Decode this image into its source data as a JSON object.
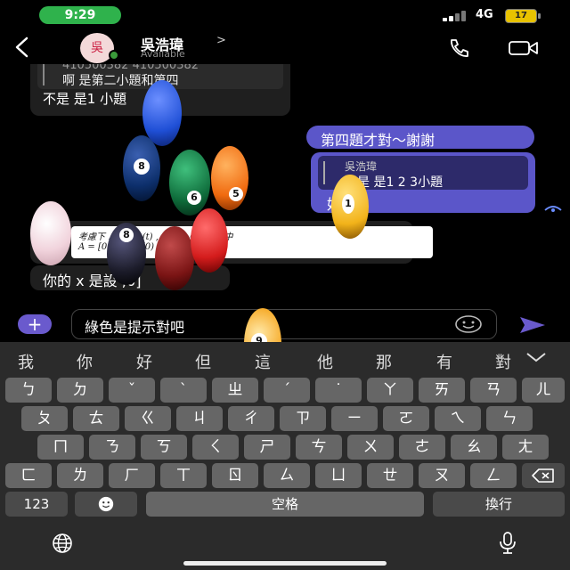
{
  "status_bar": {
    "time": "9:29",
    "network": "4G",
    "battery": "17"
  },
  "header": {
    "name": "吳浩瑋",
    "chevron": ">",
    "status": "Available",
    "avatar_text": "吳"
  },
  "messages": {
    "m1": {
      "quote_text": "410500382 410500382",
      "quote_body": "啊 是第二小題和第四",
      "body": "不是 是1 小題"
    },
    "m2": {
      "body": "第四題才對～謝謝"
    },
    "m3": {
      "quote_name": "吳浩瑋",
      "quote_body": "不是 是1 2 3小題",
      "body": "好"
    },
    "m4": {
      "equation": "考慮下 …      + Bu(t) ,  y(t) = Cx(t)  其中",
      "matrix_row": "A = [0 …   0], x(0) = [5/2] ."
    },
    "m5": {
      "body": "你的 x 是設 ;0]"
    }
  },
  "composer": {
    "text": "綠色是提示對吧",
    "plus_label": "+"
  },
  "keyboard": {
    "suggestions": [
      "我",
      "你",
      "好",
      "但",
      "這",
      "他",
      "那",
      "有",
      "對"
    ],
    "row1": [
      "ㄅ",
      "ㄉ",
      "ˇ",
      "ˋ",
      "ㄓ",
      "ˊ",
      "˙",
      "ㄚ",
      "ㄞ",
      "ㄢ",
      "ㄦ"
    ],
    "row2": [
      "ㄆ",
      "ㄊ",
      "ㄍ",
      "ㄐ",
      "ㄔ",
      "ㄗ",
      "ㄧ",
      "ㄛ",
      "ㄟ",
      "ㄣ"
    ],
    "row3": [
      "ㄇ",
      "ㄋ",
      "ㄎ",
      "ㄑ",
      "ㄕ",
      "ㄘ",
      "ㄨ",
      "ㄜ",
      "ㄠ",
      "ㄤ"
    ],
    "row4": [
      "ㄈ",
      "ㄌ",
      "ㄏ",
      "ㄒ",
      "ㄖ",
      "ㄙ",
      "ㄩ",
      "ㄝ",
      "ㄡ",
      "ㄥ"
    ],
    "numbers_key": "123",
    "space_key": "空格",
    "return_key": "換行"
  },
  "balls": [
    {
      "number": "",
      "color": "#1f4fd6"
    },
    {
      "number": "8",
      "color": "#0d2f6b"
    },
    {
      "number": "6",
      "color": "#0e6b3a"
    },
    {
      "number": "5",
      "color": "#f06a0f"
    },
    {
      "number": "",
      "color": "#f1d3dc"
    },
    {
      "number": "8",
      "color": "#1c1c2a"
    },
    {
      "number": "",
      "color": "#7a1414"
    },
    {
      "number": "",
      "color": "#d41c1c"
    },
    {
      "number": "1",
      "color": "#f2b31a"
    },
    {
      "number": "9",
      "color": "#f5a41c"
    }
  ],
  "colors": {
    "accent": "#6a5acd",
    "incoming": "#1f1f1f",
    "outgoing": "#5b56c9",
    "online": "#2fb24c"
  }
}
